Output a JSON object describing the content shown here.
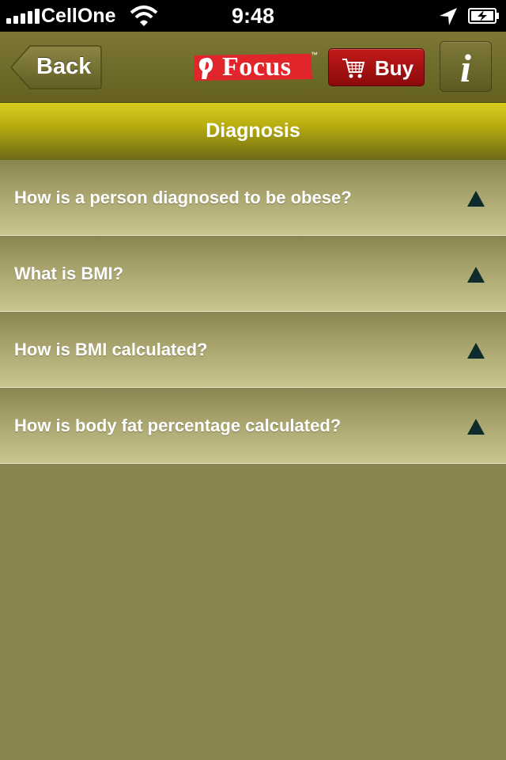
{
  "status_bar": {
    "carrier": "CellOne",
    "time": "9:48",
    "icons": [
      "signal-icon",
      "wifi-icon",
      "location-icon",
      "battery-charging-icon"
    ]
  },
  "nav_bar": {
    "back_label": "Back",
    "logo_text": "Focus",
    "logo_tm": "™",
    "buy_label": "Buy",
    "info_glyph": "i"
  },
  "section": {
    "title": "Diagnosis"
  },
  "faq": {
    "items": [
      {
        "question": "How is a person diagnosed to be obese?"
      },
      {
        "question": "What is BMI?"
      },
      {
        "question": "How is BMI calculated?"
      },
      {
        "question": "How is body fat percentage calculated?"
      }
    ]
  },
  "colors": {
    "nav_bar": "#6e6b2a",
    "section_header": "#c8bd14",
    "row_bottom": "#c9c692",
    "background": "#8a8550",
    "buy_button": "#b01414",
    "arrow": "#0f2a2a"
  }
}
